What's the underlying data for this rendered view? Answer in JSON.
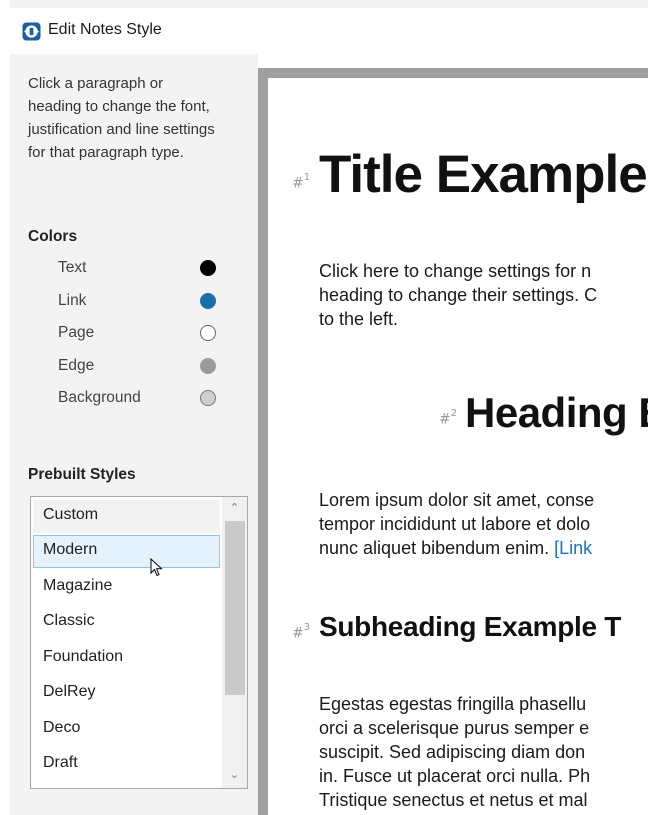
{
  "window": {
    "title": "Edit Notes Style"
  },
  "sidebar": {
    "help_text": "Click a paragraph or heading to change the font, justification and line settings for that paragraph type.",
    "colors_title": "Colors",
    "colors": [
      {
        "label": "Text",
        "color": "#000000"
      },
      {
        "label": "Link",
        "color": "#1a6ea8"
      },
      {
        "label": "Page",
        "color": "#ffffff"
      },
      {
        "label": "Edge",
        "color": "#9a9a9a"
      },
      {
        "label": "Background",
        "color": "#cfcfcf"
      }
    ],
    "prebuilt_title": "Prebuilt Styles",
    "styles": [
      "Custom",
      "Modern",
      "Magazine",
      "Classic",
      "Foundation",
      "DelRey",
      "Deco",
      "Draft"
    ],
    "selected_style": "Modern"
  },
  "preview": {
    "title": {
      "number": "1",
      "text": "Title Example"
    },
    "para1": [
      "Click here to change settings for n",
      "heading to change their settings. C",
      "to the left."
    ],
    "heading": {
      "number": "2",
      "text": "Heading E"
    },
    "para2": [
      "Lorem ipsum dolor sit amet, conse",
      "tempor incididunt ut labore et dolo",
      "nunc aliquet bibendum enim. "
    ],
    "para2_link": "[Link",
    "subheading": {
      "number": "3",
      "text": "Subheading Example T"
    },
    "para3": [
      "Egestas egestas fringilla phasellu",
      "orci a scelerisque purus semper e",
      "suscipit. Sed adipiscing diam don",
      "in. Fusce ut placerat orci nulla. Ph",
      "Tristique senectus et netus et mal"
    ]
  }
}
